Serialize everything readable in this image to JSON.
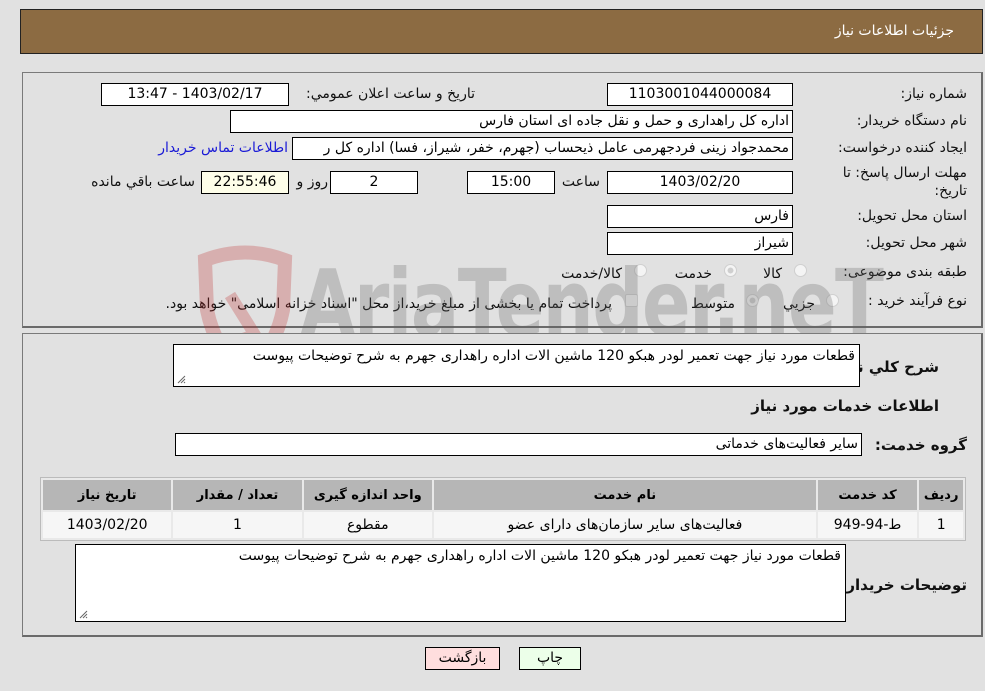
{
  "header": {
    "title": "جزئیات اطلاعات نیاز"
  },
  "fields": {
    "need_number": {
      "label": "شماره نیاز:",
      "value": "1103001044000084"
    },
    "announce_datetime": {
      "label": "تاریخ و ساعت اعلان عمومي:",
      "value": "1403/02/17 - 13:47"
    },
    "buyer_org": {
      "label": "نام دستگاه خريدار:",
      "value": "اداره کل راهداری و حمل و نقل جاده ای استان فارس"
    },
    "requester": {
      "label": "ایجاد کننده درخواست:",
      "value": "محمدجواد زینی فردجهرمی عامل ذیحساب (جهرم، خفر، شیراز، فسا) اداره کل ر"
    },
    "buyer_contact_link": "اطلاعات تماس خریدار",
    "deadline": {
      "label": "مهلت ارسال پاسخ: تا تاریخ:",
      "date": "1403/02/20",
      "time_label": "ساعت",
      "time": "15:00",
      "days": "2",
      "days_label": "روز و",
      "remaining": "22:55:46",
      "remaining_label": "ساعت باقي مانده"
    },
    "delivery_province": {
      "label": "استان محل تحویل:",
      "value": "فارس"
    },
    "delivery_city": {
      "label": "شهر محل تحویل:",
      "value": "شیراز"
    },
    "category": {
      "label": "طبقه بندی موضوعی:",
      "options": [
        "کالا",
        "خدمت",
        "کالا/خدمت"
      ],
      "selected": "خدمت"
    },
    "purchase_type": {
      "label": "نوع فرآیند خرید :",
      "options": [
        "جزيي",
        "متوسط"
      ],
      "selected": "متوسط",
      "treasury_note": "پرداخت تمام یا بخشی از مبلغ خرید،از محل \"اسناد خزانه اسلامی\" خواهد بود.",
      "treasury_checked": false
    }
  },
  "details": {
    "general_desc_label": "شرح كلي نياز:",
    "general_desc": "قطعات مورد نیاز جهت تعمیر لودر هبکو 120 ماشین الات اداره راهداری جهرم به شرح توضیحات پیوست",
    "services_title": "اطلاعات خدمات مورد نياز",
    "service_group_label": "گروه خدمت:",
    "service_group": "سایر فعالیت‌های خدماتی",
    "table": {
      "headers": [
        "ردیف",
        "کد خدمت",
        "نام خدمت",
        "واحد اندازه گیری",
        "تعداد / مقدار",
        "تاریخ نیاز"
      ],
      "rows": [
        [
          "1",
          "ط-94-949",
          "فعالیت‌های سایر سازمان‌های دارای عضو",
          "مقطوع",
          "1",
          "1403/02/20"
        ]
      ]
    },
    "buyer_notes_label": "توضیحات خریدار:",
    "buyer_notes": "قطعات مورد نیاز جهت تعمیر لودر هبکو 120 ماشین الات اداره راهداری جهرم به شرح توضیحات پیوست"
  },
  "buttons": {
    "print": "چاپ",
    "back": "بازگشت"
  },
  "watermark": "AriaTender.neT",
  "colors": {
    "header_bg": "#8c6b42",
    "print_bg": "#ecffe9",
    "back_bg": "#ffdede",
    "link": "#1a1ad6"
  }
}
